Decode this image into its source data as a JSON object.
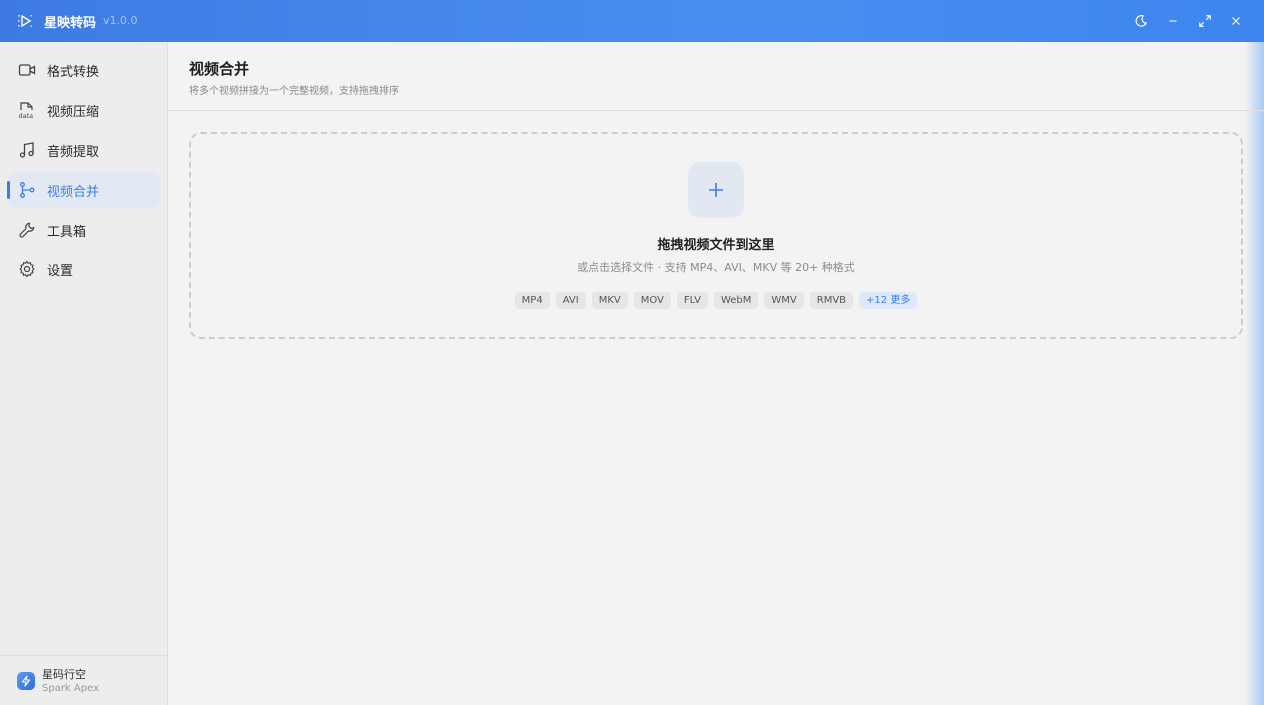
{
  "app": {
    "title": "星映转码",
    "version": "v1.0.0"
  },
  "colors": {
    "accent": "#3b7ee8",
    "titlebar": "#4a8ff0"
  },
  "window_controls": [
    {
      "name": "theme-toggle",
      "icon": "moon-icon"
    },
    {
      "name": "minimize",
      "icon": "minus-icon"
    },
    {
      "name": "maximize",
      "icon": "expand-icon"
    },
    {
      "name": "close",
      "icon": "close-icon"
    }
  ],
  "sidebar": {
    "items": [
      {
        "label": "格式转换",
        "icon": "video-camera-icon",
        "active": false
      },
      {
        "label": "视频压缩",
        "icon": "file-data-icon",
        "active": false
      },
      {
        "label": "音频提取",
        "icon": "music-note-icon",
        "active": false
      },
      {
        "label": "视频合并",
        "icon": "merge-branch-icon",
        "active": true
      },
      {
        "label": "工具箱",
        "icon": "wrench-icon",
        "active": false
      },
      {
        "label": "设置",
        "icon": "gear-icon",
        "active": false
      }
    ],
    "footer": {
      "name": "星码行空",
      "subtitle": "Spark Apex",
      "icon": "lightning-icon"
    }
  },
  "page": {
    "title": "视频合并",
    "subtitle": "将多个视频拼接为一个完整视频，支持拖拽排序"
  },
  "dropzone": {
    "icon": "plus-icon",
    "title": "拖拽视频文件到这里",
    "hint": "或点击选择文件 · 支持 MP4、AVI、MKV 等 20+ 种格式",
    "formats": [
      "MP4",
      "AVI",
      "MKV",
      "MOV",
      "FLV",
      "WebM",
      "WMV",
      "RMVB"
    ],
    "more": "+12 更多"
  }
}
